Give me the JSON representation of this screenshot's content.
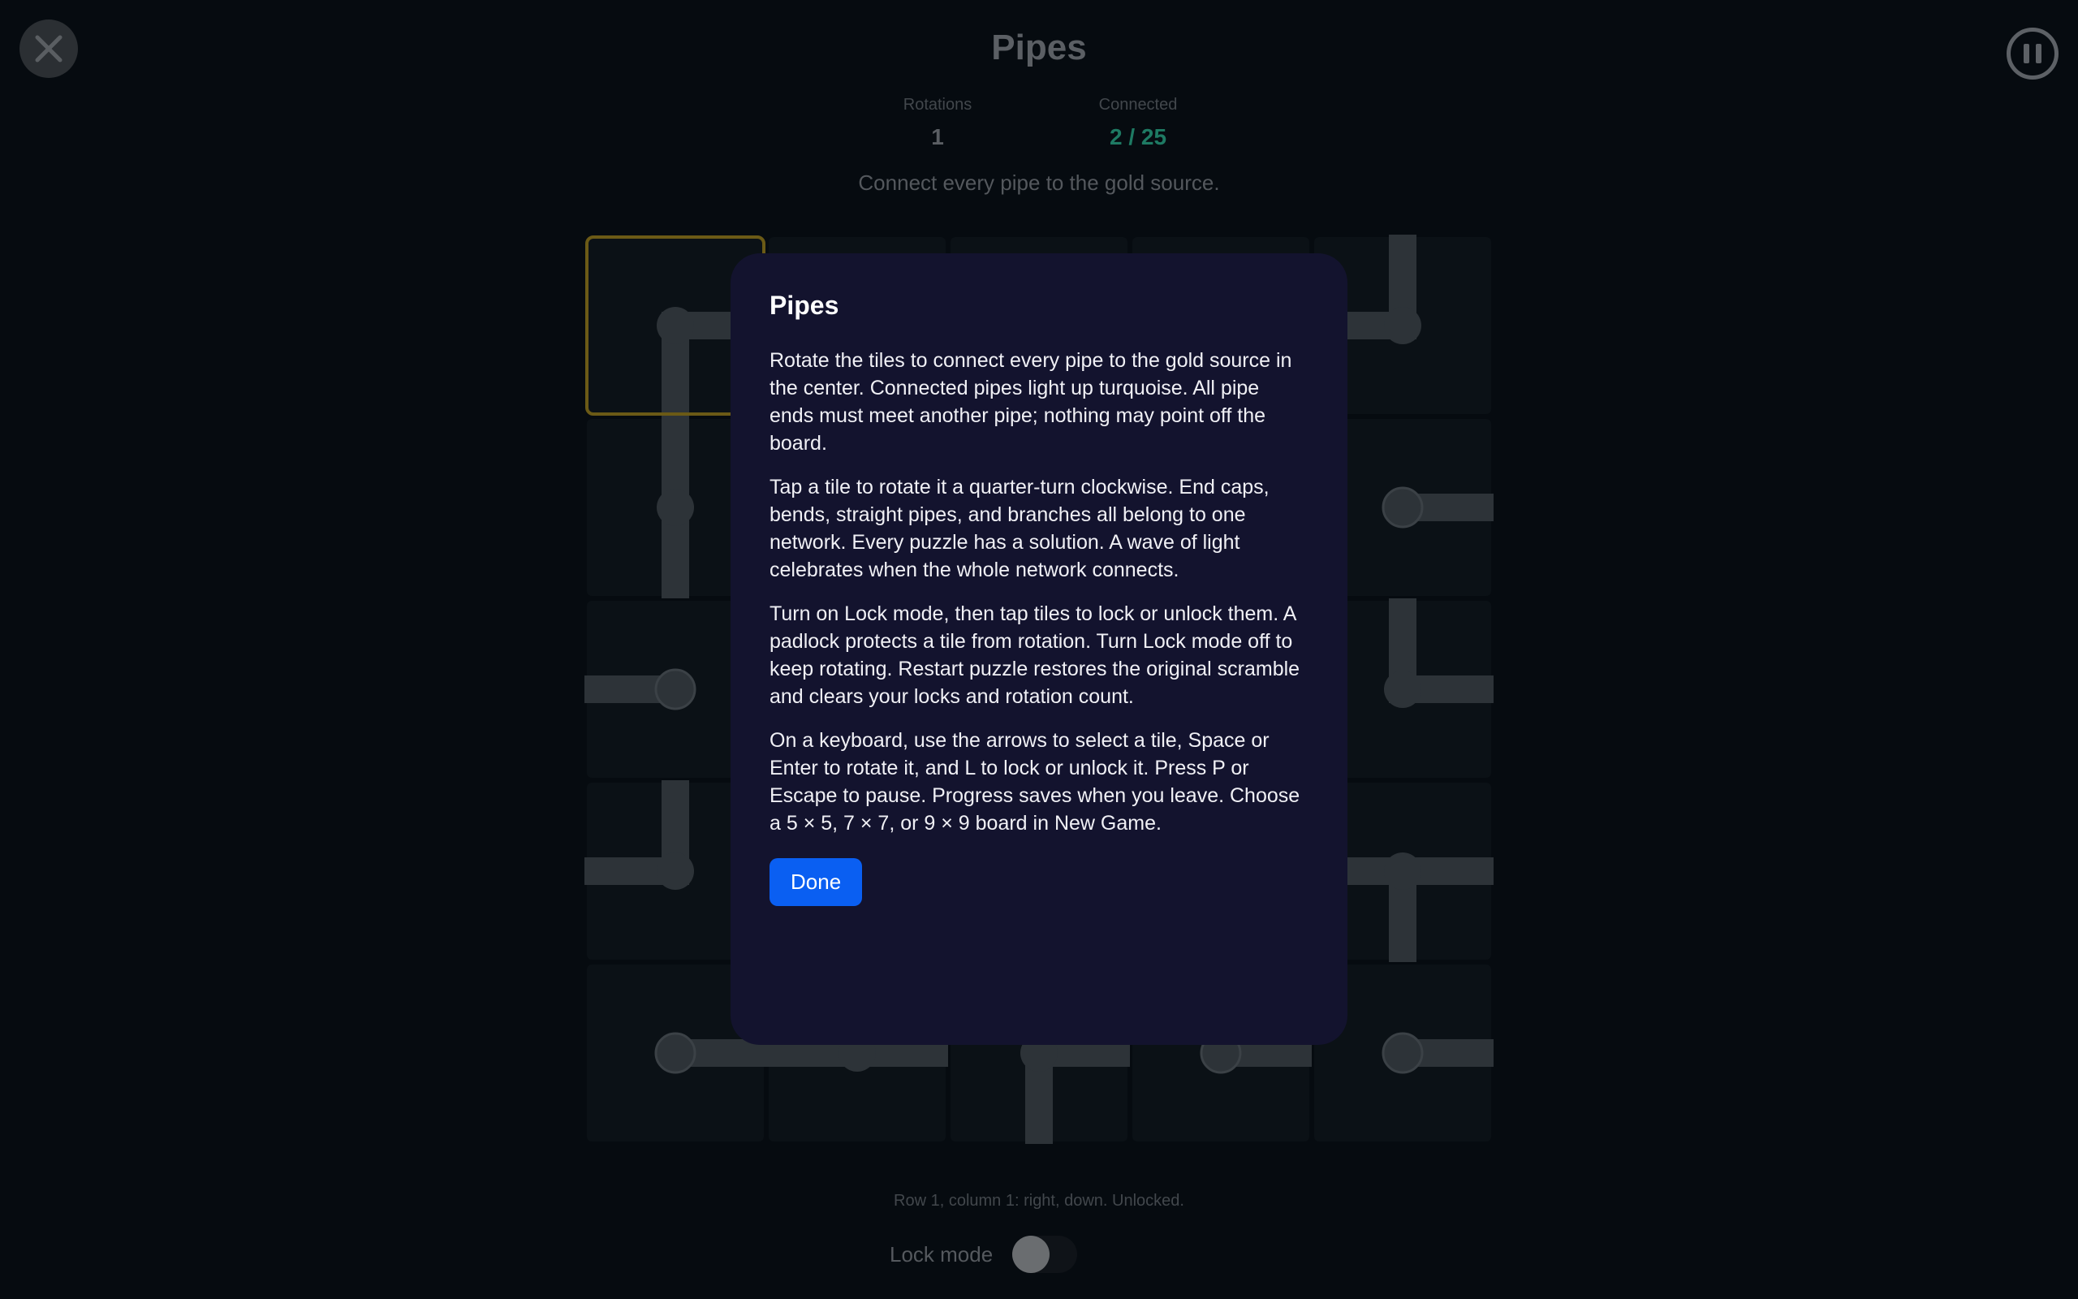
{
  "header": {
    "title": "Pipes",
    "close_icon": "close-icon",
    "pause_icon": "pause-icon"
  },
  "stats": {
    "rotations_label": "Rotations",
    "rotations_value": "1",
    "connected_label": "Connected",
    "connected_value": "2 / 25"
  },
  "instruction": "Connect every pipe to the gold source.",
  "board": {
    "size": 5,
    "selected": [
      1,
      1
    ],
    "visible_tiles": [
      {
        "row": 1,
        "col": 1,
        "dirs": [
          "right",
          "down"
        ]
      },
      {
        "row": 2,
        "col": 1,
        "dirs": [
          "up",
          "down"
        ]
      },
      {
        "row": 3,
        "col": 1,
        "dirs": [
          "left"
        ]
      },
      {
        "row": 4,
        "col": 1,
        "dirs": [
          "up",
          "left"
        ]
      },
      {
        "row": 5,
        "col": 1,
        "dirs": [
          "right"
        ]
      },
      {
        "row": 5,
        "col": 2,
        "dirs": [
          "left",
          "right"
        ]
      },
      {
        "row": 5,
        "col": 3,
        "dirs": [
          "down",
          "right"
        ]
      },
      {
        "row": 5,
        "col": 4,
        "dirs": [
          "right"
        ]
      },
      {
        "row": 5,
        "col": 5,
        "dirs": [
          "right"
        ]
      },
      {
        "row": 1,
        "col": 5,
        "dirs": [
          "up",
          "left"
        ]
      },
      {
        "row": 2,
        "col": 5,
        "dirs": [
          "right"
        ]
      },
      {
        "row": 3,
        "col": 5,
        "dirs": [
          "up",
          "right"
        ]
      },
      {
        "row": 4,
        "col": 5,
        "dirs": [
          "left",
          "right",
          "down"
        ]
      }
    ]
  },
  "status_line": "Row 1, column 1: right, down. Unlocked.",
  "lock": {
    "label": "Lock mode",
    "enabled": false
  },
  "modal": {
    "title": "Pipes",
    "paragraphs": [
      "Rotate the tiles to connect every pipe to the gold source in the center. Connected pipes light up turquoise. All pipe ends must meet another pipe; nothing may point off the board.",
      "Tap a tile to rotate it a quarter-turn clockwise. End caps, bends, straight pipes, and branches all belong to one network. Every puzzle has a solution. A wave of light celebrates when the whole network connects.",
      "Turn on Lock mode, then tap tiles to lock or unlock them. A padlock protects a tile from rotation. Turn Lock mode off to keep rotating. Restart puzzle restores the original scramble and clears your locks and rotation count.",
      "On a keyboard, use the arrows to select a tile, Space or Enter to rotate it, and L to lock or unlock it. Press P or Escape to pause. Progress saves when you leave. Choose a 5 × 5, 7 × 7, or 9 × 9 board in New Game."
    ],
    "done_label": "Done"
  },
  "colors": {
    "background": "#060b10",
    "tile": "#0b1116",
    "pipe": "#2d3338",
    "selection": "#6b5a16",
    "connected": "#1e7a63",
    "modal_bg": "#13132e",
    "primary_button": "#0a5ff2"
  }
}
